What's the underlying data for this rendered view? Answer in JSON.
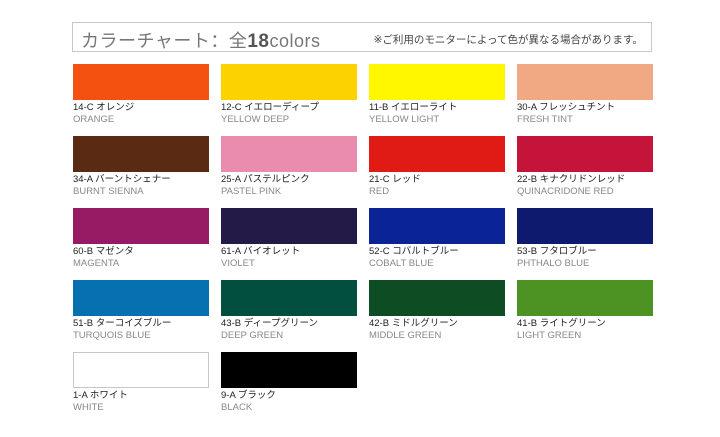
{
  "header": {
    "title_prefix": "カラーチャート：全",
    "count": "18",
    "suffix": "colors",
    "note": "※ご利用のモニターによって色が異なる場合があります。"
  },
  "swatches": [
    {
      "code": "14-C オレンジ",
      "en": "ORANGE",
      "color": "#f4500f"
    },
    {
      "code": "12-C イエローディープ",
      "en": "YELLOW DEEP",
      "color": "#fcd201"
    },
    {
      "code": "11-B イエローライト",
      "en": "YELLOW LIGHT",
      "color": "#fff700"
    },
    {
      "code": "30-A フレッシュチント",
      "en": "FRESH TINT",
      "color": "#f1a983"
    },
    {
      "code": "34-A バーントシェナー",
      "en": "BURNT SIENNA",
      "color": "#5b2a13"
    },
    {
      "code": "25-A パステルピンク",
      "en": "PASTEL PINK",
      "color": "#ea8cad"
    },
    {
      "code": "21-C レッド",
      "en": "RED",
      "color": "#e01b15"
    },
    {
      "code": "22-B キナクリドンレッド",
      "en": "QUINACRIDONE RED",
      "color": "#c4143a"
    },
    {
      "code": "60-B マゼンタ",
      "en": "MAGENTA",
      "color": "#971a65"
    },
    {
      "code": "61-A バイオレット",
      "en": "VIOLET",
      "color": "#231a48"
    },
    {
      "code": "52-C コバルトブルー",
      "en": "COBALT BLUE",
      "color": "#0a2397"
    },
    {
      "code": "53-B フタロブルー",
      "en": "PHTHALO BLUE",
      "color": "#0e1a6d"
    },
    {
      "code": "51-B ターコイズブルー",
      "en": "TURQUOIS BLUE",
      "color": "#0571b1"
    },
    {
      "code": "43-B ディープグリーン",
      "en": "DEEP GREEN",
      "color": "#034f3f"
    },
    {
      "code": "42-B ミドルグリーン",
      "en": "MIDDLE GREEN",
      "color": "#0e4d23"
    },
    {
      "code": "41-B ライトグリーン",
      "en": "LIGHT GREEN",
      "color": "#4d9323"
    },
    {
      "code": "1-A ホワイト",
      "en": "WHITE",
      "color": "#ffffff"
    },
    {
      "code": "9-A ブラック",
      "en": "BLACK",
      "color": "#000000"
    }
  ]
}
